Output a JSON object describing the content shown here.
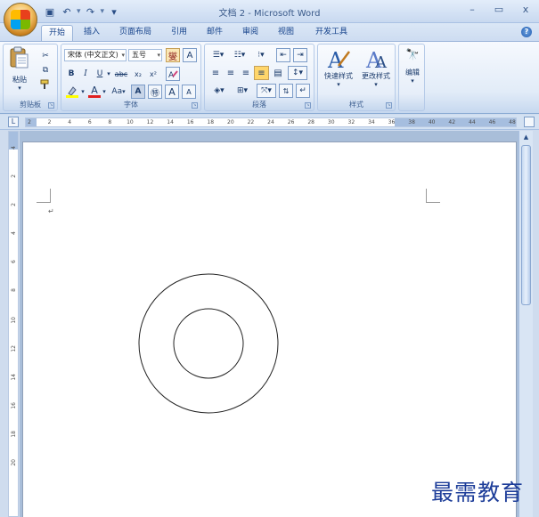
{
  "window": {
    "title": "文档 2 - Microsoft Word",
    "controls": {
      "minimize": "–",
      "restore": "▭",
      "close": "x"
    }
  },
  "quick_access": {
    "save": "💾",
    "undo": "↶",
    "redo": "↷",
    "more": "▾"
  },
  "tabs": [
    "开始",
    "插入",
    "页面布局",
    "引用",
    "邮件",
    "审阅",
    "视图",
    "开发工具"
  ],
  "active_tab": "开始",
  "ribbon": {
    "clipboard": {
      "label": "剪贴板",
      "paste": "粘贴"
    },
    "font": {
      "label": "字体",
      "font_name": "宋体 (中文正文)",
      "font_size": "五号",
      "bold": "B",
      "italic": "I",
      "underline": "U",
      "strike": "abc",
      "subscript": "x₂",
      "superscript": "x²",
      "grow": "A",
      "shrink": "A",
      "case": "Aa"
    },
    "paragraph": {
      "label": "段落"
    },
    "styles": {
      "label": "样式",
      "quick_styles": "快速样式",
      "change_styles": "更改样式"
    },
    "editing": {
      "label": "编辑"
    }
  },
  "ruler": {
    "ticks": [
      "2",
      "2",
      "4",
      "6",
      "8",
      "10",
      "12",
      "14",
      "16",
      "18",
      "20",
      "22",
      "24",
      "26",
      "28",
      "30",
      "32",
      "34",
      "36",
      "38",
      "40",
      "42",
      "44",
      "46",
      "48"
    ],
    "vertical_ticks": [
      "4",
      "2",
      "2",
      "4",
      "6",
      "8",
      "10",
      "12",
      "14",
      "16",
      "18",
      "20"
    ]
  },
  "document": {
    "paragraph_mark": "↵"
  },
  "watermark": "最需教育",
  "colors": {
    "ribbon_text": "#15428b",
    "accent": "#1e5ab0",
    "watermark": "#1d3d99"
  }
}
